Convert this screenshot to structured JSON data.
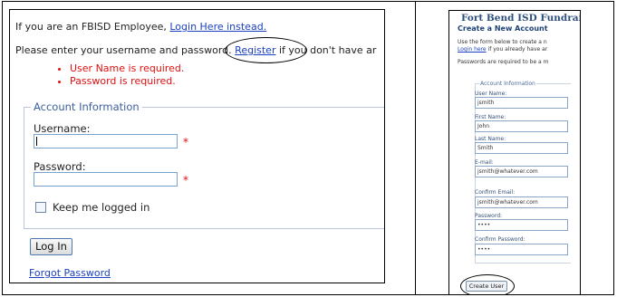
{
  "login": {
    "employee_text": "If you are an FBISD Employee, ",
    "employee_link": "Login Here instead.",
    "instructions_pre": "Please enter your username and password. ",
    "register_link": "Register",
    "instructions_post": " if you don't have ar",
    "errors": [
      "User Name is required.",
      "Password is required."
    ],
    "legend": "Account Information",
    "username_label": "Username:",
    "username_value": "",
    "password_label": "Password:",
    "password_value": "",
    "required_mark": "*",
    "remember_label": "Keep me logged in",
    "login_button": "Log In",
    "forgot_link": "Forgot Password"
  },
  "register": {
    "site_title": "Fort Bend ISD Fundrais",
    "heading": "Create a New Account",
    "intro_1": "Use the form below to create a n",
    "intro_link": "Login here",
    "intro_2": " if you already have ar",
    "password_note": "Passwords are required to be a m",
    "legend": "Account Information",
    "fields": [
      {
        "label": "User Name:",
        "value": "jsmith"
      },
      {
        "label": "First Name:",
        "value": "John"
      },
      {
        "label": "Last Name:",
        "value": "Smith"
      },
      {
        "label": "E-mail:",
        "value": "jsmith@whatever.com"
      },
      {
        "label": "Confirm Email:",
        "value": "jsmith@whatever.com"
      },
      {
        "label": "Password:",
        "value": "••••"
      },
      {
        "label": "Confirm Password:",
        "value": "••••"
      }
    ],
    "create_button": "Create User"
  },
  "colors": {
    "link": "#1a3fbf",
    "error": "#e01010",
    "legend": "#3b5f9b",
    "title": "#2d4f7c"
  }
}
